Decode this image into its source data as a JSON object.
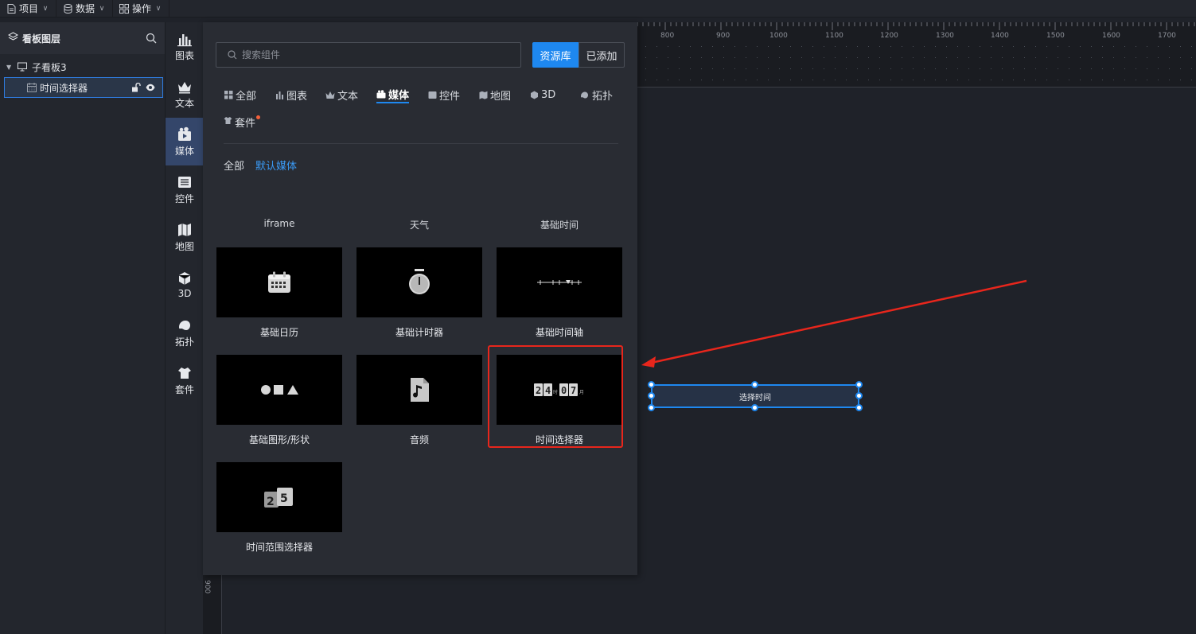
{
  "menubar": [
    {
      "label": "项目",
      "icon": "file-icon"
    },
    {
      "label": "数据",
      "icon": "database-icon"
    },
    {
      "label": "操作",
      "icon": "grid-icon"
    }
  ],
  "layers": {
    "title": "看板图层",
    "board": "子看板3",
    "item": "时间选择器"
  },
  "rail": [
    {
      "label": "图表",
      "icon": "bar-chart-icon"
    },
    {
      "label": "文本",
      "icon": "crown-icon"
    },
    {
      "label": "媒体",
      "icon": "media-icon",
      "active": true
    },
    {
      "label": "控件",
      "icon": "control-icon"
    },
    {
      "label": "地图",
      "icon": "map-icon"
    },
    {
      "label": "3D",
      "icon": "cube-icon"
    },
    {
      "label": "拓扑",
      "icon": "topology-icon"
    },
    {
      "label": "套件",
      "icon": "shirt-icon"
    }
  ],
  "panel": {
    "search_placeholder": "搜索组件",
    "btn_library": "资源库",
    "btn_added": "已添加",
    "tabs": [
      "全部",
      "图表",
      "文本",
      "媒体",
      "控件",
      "地图",
      "3D",
      "拓扑"
    ],
    "tab_kit": "套件",
    "subtabs": [
      "全部",
      "默认媒体"
    ],
    "col_heads": [
      "iframe",
      "天气",
      "基础时间"
    ],
    "cards": [
      "基础日历",
      "基础计时器",
      "基础时间轴",
      "基础图形/形状",
      "音频",
      "时间选择器",
      "时间范围选择器"
    ]
  },
  "ruler": {
    "labels": [
      "800",
      "900",
      "1000",
      "1100",
      "1200",
      "1300",
      "1400",
      "1500",
      "1600",
      "1700"
    ],
    "left_label": "900"
  },
  "canvas": {
    "widget_text": "选择时间"
  },
  "colors": {
    "accent": "#1e88f0",
    "highlight": "#e8261c"
  }
}
